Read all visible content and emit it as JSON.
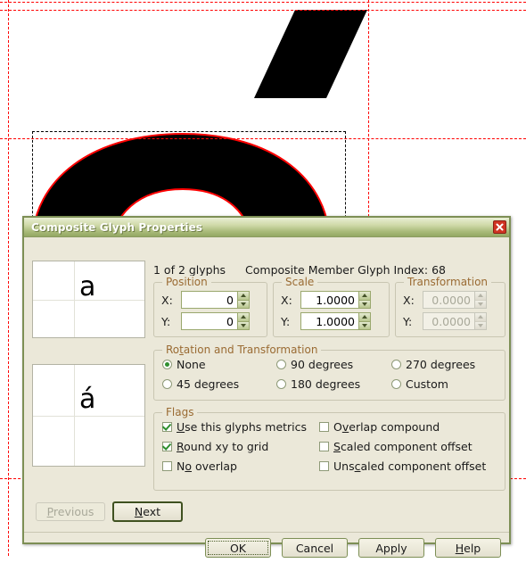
{
  "canvas": {
    "description": "FontForge glyph outline editor background",
    "glyph_outline_color": "#000000",
    "spline_color": "#ff0000",
    "guideline_color": "#ff0000",
    "bbox_color": "#000000",
    "background": "#ffffff"
  },
  "dialog": {
    "title": "Composite Glyph Properties",
    "close_icon": "close-icon",
    "accent_color": "#7d8f55",
    "header": {
      "glyph_counter": "1 of 2 glyphs",
      "member_index": "Composite Member Glyph Index: 68"
    },
    "previews": [
      {
        "char": "a",
        "name": "base-glyph-preview"
      },
      {
        "char": "á",
        "name": "composite-glyph-preview"
      }
    ],
    "position": {
      "legend": "Position",
      "x_label": "X:",
      "x_value": "0",
      "y_label": "Y:",
      "y_value": "0",
      "enabled": true
    },
    "scale": {
      "legend": "Scale",
      "x_label": "X:",
      "x_value": "1.0000",
      "y_label": "Y:",
      "y_value": "1.0000",
      "enabled": true
    },
    "transformation": {
      "legend": "Transformation",
      "x_label": "X:",
      "x_value": "0.0000",
      "y_label": "Y:",
      "y_value": "0.0000",
      "enabled": false
    },
    "rotation": {
      "legend_pre": "Ro",
      "legend_mnemonic": "t",
      "legend_post": "ation and Transformation",
      "legend_full": "Rotation and Transformation",
      "options": [
        {
          "label": "None",
          "selected": true
        },
        {
          "label": "90 degrees",
          "selected": false
        },
        {
          "label": "270 degrees",
          "selected": false
        },
        {
          "label": "45 degrees",
          "selected": false
        },
        {
          "label": "180 degrees",
          "selected": false
        },
        {
          "label": "Custom",
          "selected": false
        }
      ]
    },
    "flags": {
      "legend": "Flags",
      "options": [
        {
          "pre": "",
          "mn": "U",
          "post": "se this glyphs metrics",
          "checked": true
        },
        {
          "pre": "O",
          "mn": "v",
          "post": "erlap compound",
          "checked": false
        },
        {
          "pre": "",
          "mn": "R",
          "post": "ound xy to grid",
          "checked": true
        },
        {
          "pre": "",
          "mn": "S",
          "post": "caled component offset",
          "checked": false
        },
        {
          "pre": "N",
          "mn": "o",
          "post": " overlap",
          "checked": false
        },
        {
          "pre": "Uns",
          "mn": "c",
          "post": "aled component offset",
          "checked": false
        }
      ]
    },
    "nav": {
      "previous_pre": "",
      "previous_mn": "P",
      "previous_post": "revious",
      "previous_enabled": false,
      "next_pre": "",
      "next_mn": "N",
      "next_post": "ext",
      "next_enabled": true
    },
    "footer_buttons": [
      {
        "pre": "OK",
        "mn": "",
        "post": "",
        "default": false,
        "focus": true
      },
      {
        "pre": "Cancel",
        "mn": "",
        "post": "",
        "default": false,
        "focus": false
      },
      {
        "pre": "Apply",
        "mn": "",
        "post": "",
        "default": false,
        "focus": false
      },
      {
        "pre": "",
        "mn": "H",
        "post": "elp",
        "default": false,
        "focus": false
      }
    ]
  }
}
